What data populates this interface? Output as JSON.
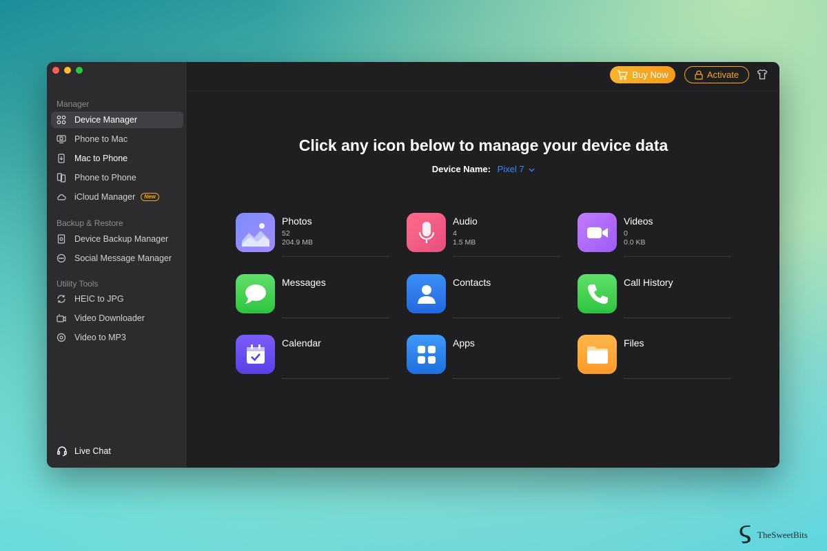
{
  "sidebar": {
    "sections": {
      "manager": "Manager",
      "backup": "Backup & Restore",
      "utility": "Utility Tools"
    },
    "items": [
      {
        "label": "Device Manager",
        "icon": "grid-command-icon",
        "active": true
      },
      {
        "label": "Phone to Mac",
        "icon": "phone-to-mac-icon"
      },
      {
        "label": "Mac to Phone",
        "icon": "mac-to-phone-icon"
      },
      {
        "label": "Phone to Phone",
        "icon": "phone-to-phone-icon"
      },
      {
        "label": "iCloud Manager",
        "icon": "cloud-icon",
        "badge": "New"
      },
      {
        "label": "Device Backup Manager",
        "icon": "backup-icon"
      },
      {
        "label": "Social Message Manager",
        "icon": "chat-bubble-icon"
      },
      {
        "label": "HEIC to JPG",
        "icon": "convert-image-icon"
      },
      {
        "label": "Video Downloader",
        "icon": "video-download-icon"
      },
      {
        "label": "Video to MP3",
        "icon": "video-to-audio-icon"
      }
    ],
    "live_chat": "Live Chat"
  },
  "topbar": {
    "buy_label": "Buy Now",
    "activate_label": "Activate"
  },
  "main": {
    "headline": "Click any icon below to manage your device data",
    "device_label": "Device Name:",
    "device_value": "Pixel 7"
  },
  "tiles": [
    {
      "name": "Photos",
      "count": "52",
      "size": "204.9 MB",
      "icon": "photos-icon"
    },
    {
      "name": "Audio",
      "count": "4",
      "size": "1.5 MB",
      "icon": "microphone-icon"
    },
    {
      "name": "Videos",
      "count": "0",
      "size": "0.0 KB",
      "icon": "video-camera-icon"
    },
    {
      "name": "Messages",
      "icon": "message-bubble-icon"
    },
    {
      "name": "Contacts",
      "icon": "contact-person-icon"
    },
    {
      "name": "Call History",
      "icon": "phone-icon"
    },
    {
      "name": "Calendar",
      "icon": "calendar-icon"
    },
    {
      "name": "Apps",
      "icon": "apps-grid-icon"
    },
    {
      "name": "Files",
      "icon": "folder-icon"
    }
  ],
  "watermark": "TheSweetBits",
  "colors": {
    "accent_orange": "#f5a623",
    "link_blue": "#2f8cff",
    "sidebar_bg": "#2c2c2e",
    "main_bg": "#1f1f21"
  }
}
